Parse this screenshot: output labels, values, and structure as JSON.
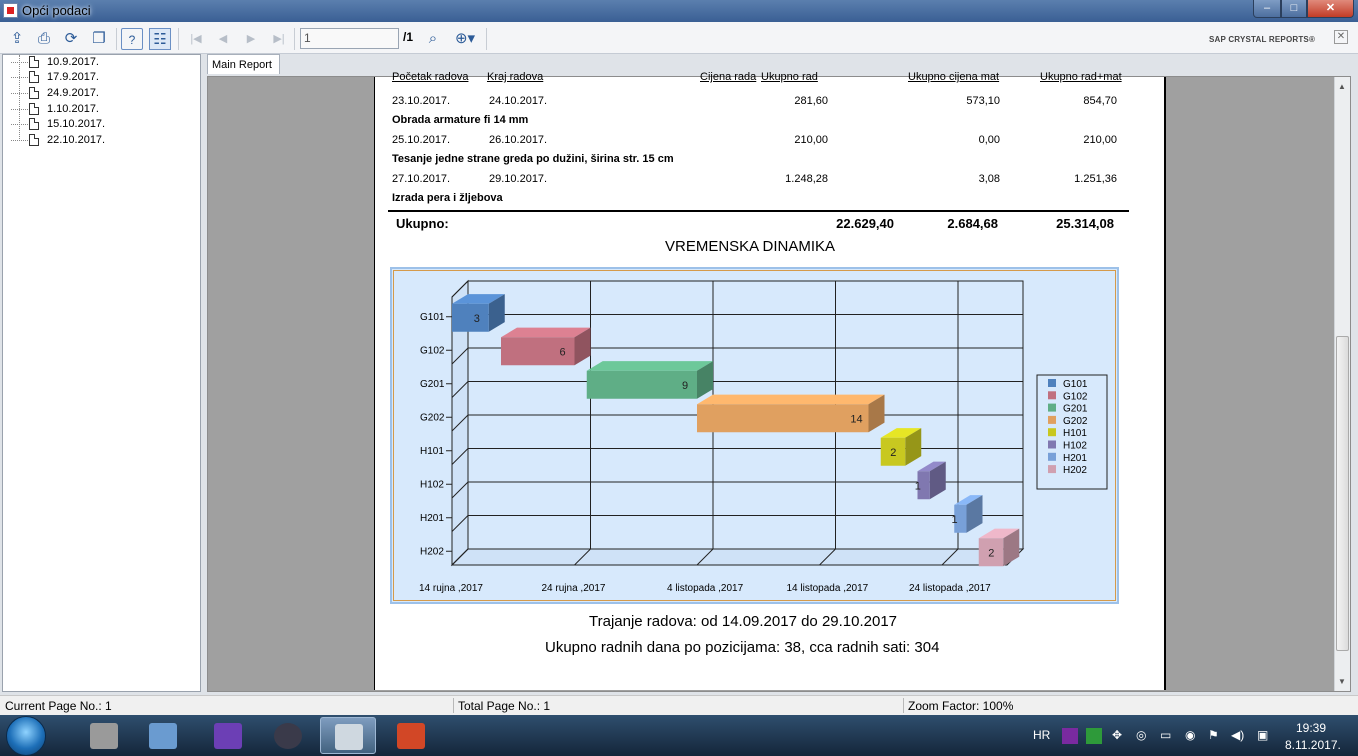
{
  "window": {
    "title": "Opći podaci",
    "min": "–",
    "max": "□",
    "close": "✕"
  },
  "toolbar": {
    "page_value": "1",
    "page_total": "/1",
    "brand": "SAP CRYSTAL REPORTS®",
    "close_glyph": "✕"
  },
  "tree": {
    "items": [
      "10.9.2017.",
      "17.9.2017.",
      "24.9.2017.",
      "1.10.2017.",
      "15.10.2017.",
      "22.10.2017."
    ]
  },
  "tab": {
    "label": "Main Report"
  },
  "report": {
    "headers": [
      "Početak radova",
      "Kraj radova",
      "Cijena rada",
      "Ukupno rad",
      "Ukupno cijena mat",
      "Ukupno rad+mat"
    ],
    "rows": [
      {
        "start": "23.10.2017.",
        "end": "24.10.2017.",
        "rad": "281,60",
        "mat": "573,10",
        "total": "854,70"
      },
      {
        "desc": "Obrada armature fi 14 mm"
      },
      {
        "start": "25.10.2017.",
        "end": "26.10.2017.",
        "rad": "210,00",
        "mat": "0,00",
        "total": "210,00"
      },
      {
        "desc": "Tesanje jedne strane greda po dužini, širina str. 15 cm"
      },
      {
        "start": "27.10.2017.",
        "end": "29.10.2017.",
        "rad": "1.248,28",
        "mat": "3,08",
        "total": "1.251,36"
      },
      {
        "desc": "Izrada pera i žljebova"
      }
    ],
    "total_label": "Ukupno:",
    "total_rad": "22.629,40",
    "total_mat": "2.684,68",
    "total_all": "25.314,08",
    "chart_title": "VREMENSKA DINAMIKA",
    "duration": "Trajanje radova: od 14.09.2017 do 29.10.2017",
    "workdays": "Ukupno radnih dana po pozicijama: 38, cca radnih sati: 304"
  },
  "chart_data": {
    "type": "bar",
    "orientation": "horizontal-gantt",
    "title": "",
    "categories": [
      "G101",
      "G102",
      "G201",
      "G202",
      "H101",
      "H102",
      "H201",
      "H202"
    ],
    "series": [
      {
        "name": "G101",
        "start": "2017-09-14",
        "days": 3,
        "color": "#4f81bd"
      },
      {
        "name": "G102",
        "start": "2017-09-18",
        "days": 6,
        "color": "#c0707f"
      },
      {
        "name": "G201",
        "start": "2017-09-25",
        "days": 9,
        "color": "#5fae86"
      },
      {
        "name": "G202",
        "start": "2017-10-04",
        "days": 14,
        "color": "#e0a060"
      },
      {
        "name": "H101",
        "start": "2017-10-19",
        "days": 2,
        "color": "#c8c820"
      },
      {
        "name": "H102",
        "start": "2017-10-22",
        "days": 1,
        "color": "#8078b0"
      },
      {
        "name": "H201",
        "start": "2017-10-25",
        "days": 1,
        "color": "#78a0d8"
      },
      {
        "name": "H202",
        "start": "2017-10-27",
        "days": 2,
        "color": "#d0a0b0"
      }
    ],
    "x_ticks": [
      "14 rujna ,2017",
      "24 rujna ,2017",
      "4 listopada ,2017",
      "14 listopada ,2017",
      "24 listopada ,2017"
    ],
    "legend": [
      "G101",
      "G102",
      "G201",
      "G202",
      "H101",
      "H102",
      "H201",
      "H202"
    ],
    "legend_position": "right",
    "grid": true
  },
  "status": {
    "current_page": "Current Page No.: 1",
    "total_page": "Total Page No.: 1",
    "zoom": "Zoom Factor: 100%"
  },
  "taskbar": {
    "lang": "HR",
    "time": "19:39",
    "date": "8.11.2017."
  }
}
